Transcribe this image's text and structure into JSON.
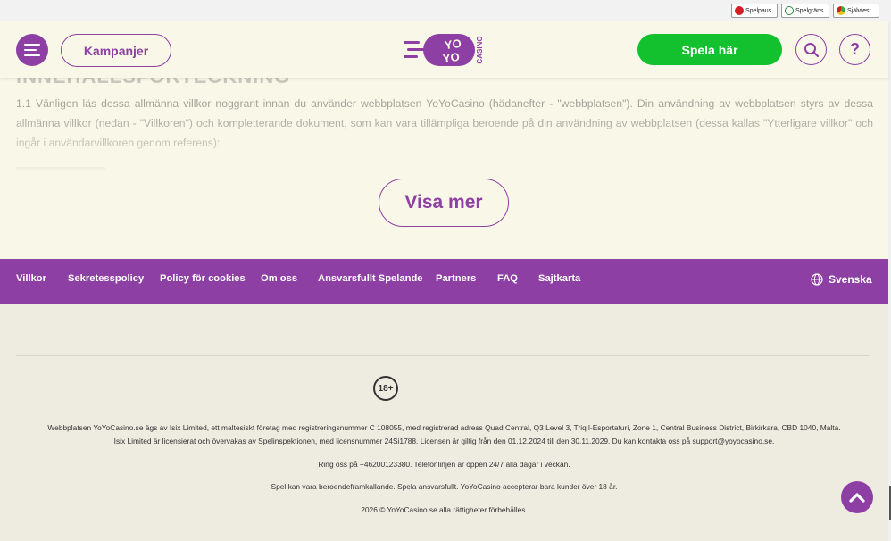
{
  "topbar": {
    "spelpaus": "Spelpaus",
    "spelgrans": "Spelgräns",
    "sjalvtest": "Självtest"
  },
  "header": {
    "campaigns_label": "Kampanjer",
    "logo_text_1": "YO",
    "logo_text_2": "YO",
    "logo_text_3": "CASINO",
    "play_label": "Spela här",
    "help_label": "?",
    "icons": [
      "menu-icon",
      "search-icon",
      "help-icon"
    ]
  },
  "content": {
    "heading": "INNEHÅLLSFÖRTECKNING",
    "paragraph": "1.1 Vänligen läs dessa allmänna villkor noggrant innan du använder webbplatsen YoYoCasino (hädanefter - \"webbplatsen\"). Din användning av webbplatsen styrs av dessa allmänna villkor (nedan - \"Villkoren\") och kompletterande dokument, som kan vara tillämpliga beroende på din användning av webbplatsen (dessa kallas \"Ytterligare villkor\" och ingår i användarvillkoren genom referens):",
    "show_more_label": "Visa mer"
  },
  "footer_nav": {
    "links": [
      "Villkor",
      "Sekretesspolicy",
      "Policy för cookies",
      "Om oss",
      "Ansvarsfullt Spelande",
      "Partners",
      "FAQ",
      "Sajtkarta"
    ],
    "language": "Svenska"
  },
  "footer": {
    "age_badge": "18+",
    "company_line_1": "Webbplatsen YoYoCasino.se ägs av Isix Limited, ett maltesiskt företag med registreringsnummer C 108055, med registrerad adress Quad Central, Q3 Level 3, Triq l-Esportaturi, Zone 1, Central Business District, Birkirkara, CBD 1040, Malta.",
    "company_line_2": "Isix Limited är licensierat och övervakas av Spelinspektionen, med licensnummer 24Si1788. Licensen är giltig från den 01.12.2024 till den 30.11.2029. Du kan kontakta oss på support@yoyocasino.se.",
    "phone_line": "Ring oss på +46200123380. Telefonlinjen är öppen 24/7 alla dagar i veckan.",
    "responsible_line": "Spel kan vara beroendeframkallande. Spela ansvarsfullt. YoYoCasino accepterar bara kunder över 18 år.",
    "copyright": "2026 © YoYoCasino.se alla rättigheter förbehålles."
  },
  "colors": {
    "brand_purple": "#8e3fa4",
    "play_green": "#13c02e",
    "header_bg": "#f9f8e8",
    "footer_bg": "#eeebe0"
  }
}
